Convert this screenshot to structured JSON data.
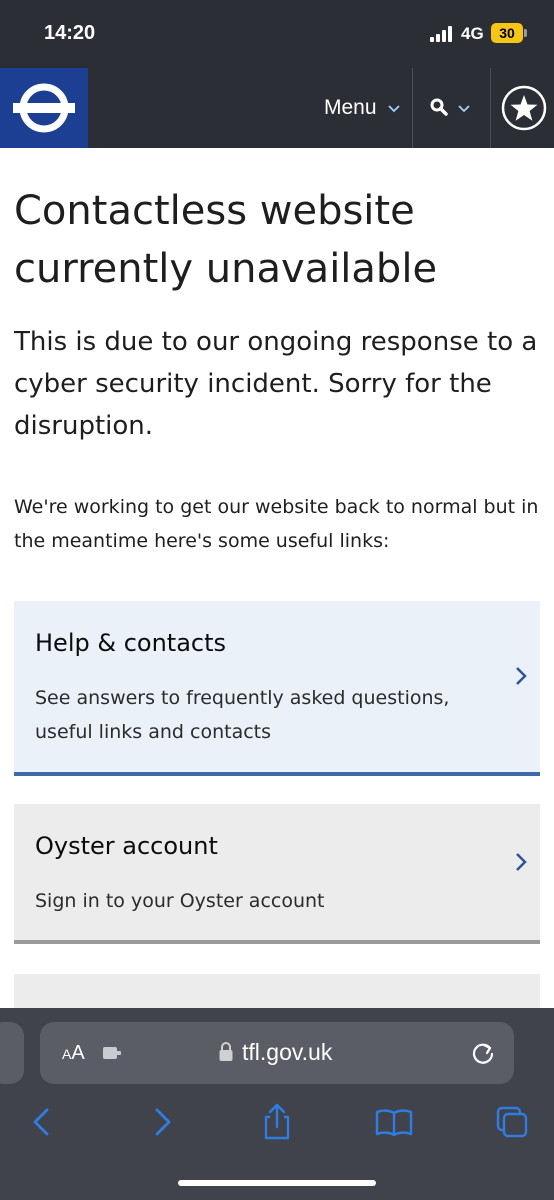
{
  "status_bar": {
    "time": "14:20",
    "network": "4G",
    "battery": "30"
  },
  "header": {
    "logo": "tfl-roundel-logo",
    "menu_label": "Menu",
    "icons": [
      "chevron-down-icon",
      "search-icon",
      "star-icon"
    ]
  },
  "main": {
    "title": "Contactless website currently unavailable",
    "lead": "This is due to our ongoing response to a cyber security incident. Sorry for the disruption.",
    "body": "We're working to get our website back to normal but in the meantime here's some useful links:",
    "cards": [
      {
        "title": "Help & contacts",
        "description": "See answers to frequently asked questions, useful links and contacts"
      },
      {
        "title": "Oyster account",
        "description": "Sign in to your Oyster account"
      }
    ]
  },
  "browser": {
    "aa_small": "A",
    "aa_big": "A",
    "url": "tfl.gov.uk",
    "toolbar_icons": [
      "back-icon",
      "forward-icon",
      "share-icon",
      "bookmarks-icon",
      "tabs-icon"
    ]
  },
  "colors": {
    "header_bg": "#2c2e35",
    "logo_blue": "#1c3f94",
    "card_help_bg": "#eaf1f9",
    "card_help_border": "#3e6aad",
    "card_grey_bg": "#ececec",
    "browser_chrome": "#40434b",
    "link_blue": "#2f7de1"
  }
}
